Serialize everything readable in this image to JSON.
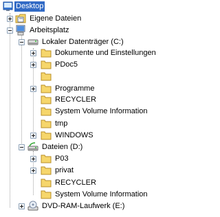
{
  "tree": {
    "desktop": "Desktop",
    "eigene_dateien": "Eigene Dateien",
    "arbeitsplatz": "Arbeitsplatz",
    "drive_c": {
      "label": "Lokaler Datenträger (C:)",
      "children": [
        "Dokumente und Einstellungen",
        "PDoc5",
        "",
        "Programme",
        "RECYCLER",
        "System Volume Information",
        "tmp",
        "WINDOWS"
      ]
    },
    "drive_d": {
      "label": "Dateien (D:)",
      "children": [
        "P03",
        "privat",
        "RECYCLER",
        "System Volume Information"
      ]
    },
    "drive_e": "DVD-RAM-Laufwerk (E:)"
  },
  "colors": {
    "selection": "#316ac5",
    "folder": "#f6d66b",
    "tree_line": "#a0a0a0"
  },
  "icons": {
    "desktop": "desktop-icon",
    "eigene_dateien": "my-documents-icon",
    "arbeitsplatz": "my-computer-icon",
    "drive_c": "hard-drive-icon",
    "drive_d": "shared-drive-icon",
    "drive_e": "dvd-drive-icon",
    "folders": "folder-icon"
  }
}
